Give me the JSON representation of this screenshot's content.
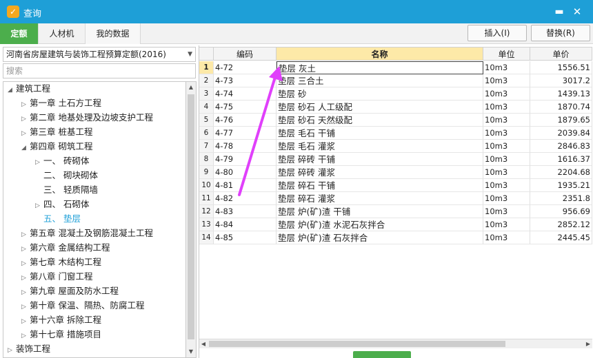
{
  "window": {
    "title": "查询"
  },
  "tabs": [
    "定额",
    "人材机",
    "我的数据"
  ],
  "toolbar": {
    "insert_label": "插入(I)",
    "replace_label": "替换(R)"
  },
  "left": {
    "quota_select": "河南省房屋建筑与装饰工程预算定额(2016)",
    "search_placeholder": "搜索",
    "tree": [
      {
        "label": "建筑工程",
        "level": 0,
        "expanded": true
      },
      {
        "label": "第一章 土石方工程",
        "level": 1,
        "expanded": false
      },
      {
        "label": "第二章 地基处理及边坡支护工程",
        "level": 1,
        "expanded": false
      },
      {
        "label": "第三章 桩基工程",
        "level": 1,
        "expanded": false
      },
      {
        "label": "第四章 砌筑工程",
        "level": 1,
        "expanded": true
      },
      {
        "label": "一、 砖砌体",
        "level": 2,
        "expanded": false
      },
      {
        "label": "二、 砌块砌体",
        "level": 2,
        "leaf": true
      },
      {
        "label": "三、 轻质隔墙",
        "level": 2,
        "leaf": true
      },
      {
        "label": "四、 石砌体",
        "level": 2,
        "expanded": false
      },
      {
        "label": "五、 垫层",
        "level": 2,
        "leaf": true,
        "selected": true
      },
      {
        "label": "第五章 混凝土及钢筋混凝土工程",
        "level": 1,
        "expanded": false
      },
      {
        "label": "第六章 金属结构工程",
        "level": 1,
        "expanded": false
      },
      {
        "label": "第七章 木结构工程",
        "level": 1,
        "expanded": false
      },
      {
        "label": "第八章 门窗工程",
        "level": 1,
        "expanded": false
      },
      {
        "label": "第九章 屋面及防水工程",
        "level": 1,
        "expanded": false
      },
      {
        "label": "第十章 保温、隔热、防腐工程",
        "level": 1,
        "expanded": false
      },
      {
        "label": "第十六章 拆除工程",
        "level": 1,
        "expanded": false
      },
      {
        "label": "第十七章 措施项目",
        "level": 1,
        "expanded": false
      },
      {
        "label": "装饰工程",
        "level": 0,
        "expanded": false
      }
    ]
  },
  "grid": {
    "columns": [
      "编码",
      "名称",
      "单位",
      "单价"
    ],
    "rows": [
      {
        "no": "1",
        "code": "4-72",
        "name": "垫层 灰土",
        "unit": "10m3",
        "price": "1556.51"
      },
      {
        "no": "2",
        "code": "4-73",
        "name": "垫层 三合土",
        "unit": "10m3",
        "price": "3017.2"
      },
      {
        "no": "3",
        "code": "4-74",
        "name": "垫层 砂",
        "unit": "10m3",
        "price": "1439.13"
      },
      {
        "no": "4",
        "code": "4-75",
        "name": "垫层 砂石 人工级配",
        "unit": "10m3",
        "price": "1870.74"
      },
      {
        "no": "5",
        "code": "4-76",
        "name": "垫层 砂石 天然级配",
        "unit": "10m3",
        "price": "1879.65"
      },
      {
        "no": "6",
        "code": "4-77",
        "name": "垫层 毛石 干铺",
        "unit": "10m3",
        "price": "2039.84"
      },
      {
        "no": "7",
        "code": "4-78",
        "name": "垫层 毛石 灌浆",
        "unit": "10m3",
        "price": "2846.83"
      },
      {
        "no": "8",
        "code": "4-79",
        "name": "垫层 碎砖 干铺",
        "unit": "10m3",
        "price": "1616.37"
      },
      {
        "no": "9",
        "code": "4-80",
        "name": "垫层 碎砖 灌浆",
        "unit": "10m3",
        "price": "2204.68"
      },
      {
        "no": "10",
        "code": "4-81",
        "name": "垫层 碎石 干铺",
        "unit": "10m3",
        "price": "1935.21"
      },
      {
        "no": "11",
        "code": "4-82",
        "name": "垫层 碎石 灌浆",
        "unit": "10m3",
        "price": "2351.8"
      },
      {
        "no": "12",
        "code": "4-83",
        "name": "垫层 炉(矿)渣 干铺",
        "unit": "10m3",
        "price": "956.69"
      },
      {
        "no": "13",
        "code": "4-84",
        "name": "垫层 炉(矿)渣 水泥石灰拌合",
        "unit": "10m3",
        "price": "2852.12"
      },
      {
        "no": "14",
        "code": "4-85",
        "name": "垫层 炉(矿)渣 石灰拌合",
        "unit": "10m3",
        "price": "2445.45"
      }
    ]
  },
  "colors": {
    "titlebar": "#1e9fd7",
    "active_tab": "#4cae4c",
    "annotation_arrow": "#e040fb",
    "header_highlight": "#fde9a8"
  }
}
